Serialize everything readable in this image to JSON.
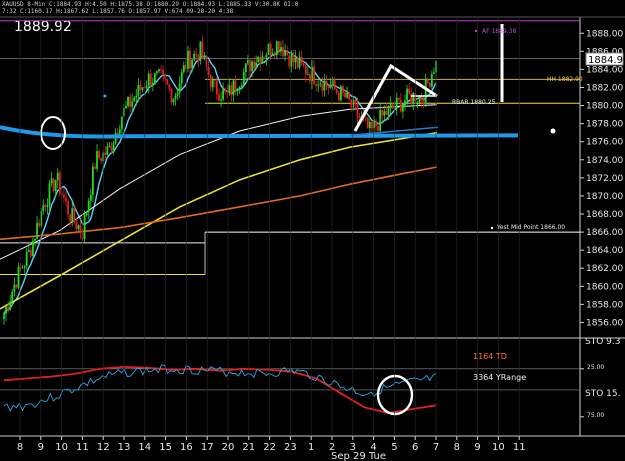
{
  "header": {
    "line1": "XAUUSD 8-Min C:1884.93 H:4.50 H:1875.38 O:1880.29 O:1884.93 L:1885.33 V:30.8K OI:0",
    "line2": "7:32 C:1160.17 H:1867.62 L:1857.76 O:1857.97 V:674 09-28-20 4:38"
  },
  "price_label": "1889.92",
  "current_price": "1884.93",
  "x_date_label": "Sep 29 Tue",
  "annotations": {
    "hh": "HH 1882.90",
    "rbar": "RBAR 1880.25",
    "mid_point": "Yest Mid Point 1866.00",
    "af": "AF 1889.38",
    "td": "1164 TD",
    "yrange": "3364 YRange"
  },
  "sto_labels": {
    "top": "STO 9.3",
    "mid": "STO 15."
  },
  "osc_ticks": [
    "25.00",
    "75.00"
  ],
  "colors": {
    "bg": "#000000",
    "up": "#22d822",
    "down": "#e02020",
    "blue": "#1e9ae8",
    "cyan": "#5fd0ff",
    "yellow": "#e8e23a",
    "orange": "#e06a22",
    "white": "#ffffff",
    "magenta": "#c83ad0"
  },
  "chart_data": [
    {
      "type": "candlestick",
      "xlabel": "",
      "ylabel": "",
      "x_ticks": [
        "8",
        "9",
        "10",
        "11",
        "12",
        "13",
        "14",
        "15",
        "16",
        "17",
        "20",
        "21",
        "22",
        "23",
        "1",
        "2",
        "3",
        "4",
        "5",
        "6",
        "7",
        "8",
        "9",
        "10",
        "11"
      ],
      "y_ticks": [
        1856,
        1858,
        1860,
        1862,
        1864,
        1866,
        1868,
        1870,
        1872,
        1874,
        1876,
        1878,
        1880,
        1882,
        1884,
        1886,
        1888
      ],
      "ylim": [
        1854.5,
        1889.8
      ],
      "last_close": 1884.93,
      "ohlc_path": [
        1857,
        1861,
        1864,
        1869,
        1872,
        1868,
        1866,
        1874,
        1875,
        1879,
        1881,
        1883,
        1883,
        1881,
        1885,
        1886,
        1882,
        1881,
        1883,
        1885,
        1886,
        1887,
        1885,
        1884,
        1883,
        1882,
        1881,
        1879,
        1877,
        1879,
        1880,
        1881,
        1881,
        1885
      ],
      "horizontal_levels": [
        {
          "name": "AF",
          "value": 1889.38
        },
        {
          "name": "HH",
          "value": 1882.9
        },
        {
          "name": "RBAR",
          "value": 1880.25
        },
        {
          "name": "Yest Mid Point",
          "value": 1866.0
        }
      ]
    },
    {
      "type": "line",
      "series": [
        {
          "values": [
            42,
            40,
            38,
            35,
            30,
            28,
            29,
            31,
            30,
            32,
            30,
            31,
            33,
            40,
            55,
            70,
            76,
            72,
            68
          ]
        },
        {
          "values": [
            70,
            68,
            60,
            50,
            40,
            34,
            32,
            30,
            31,
            33,
            34,
            35,
            32,
            38,
            48,
            56,
            50,
            44,
            40
          ]
        }
      ]
    }
  ]
}
